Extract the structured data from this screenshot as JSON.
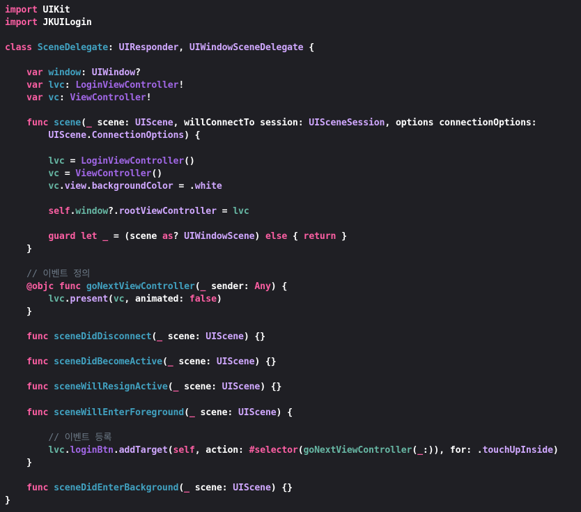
{
  "colors": {
    "background": "#1f1f24",
    "plain": "#ffffff",
    "keyword": "#fc5fa3",
    "type": "#d0a8ff",
    "project_type": "#a167e6",
    "declaration": "#41a1c0",
    "project_name": "#67b7a4",
    "project_member": "#a167e6",
    "comment": "#6c7986"
  },
  "lines": [
    [
      [
        "keyword",
        "import"
      ],
      [
        "plain",
        " UIKit"
      ]
    ],
    [
      [
        "keyword",
        "import"
      ],
      [
        "plain",
        " JKUILogin"
      ]
    ],
    [],
    [
      [
        "keyword",
        "class"
      ],
      [
        "plain",
        " "
      ],
      [
        "declaration",
        "SceneDelegate"
      ],
      [
        "plain",
        ": "
      ],
      [
        "type",
        "UIResponder"
      ],
      [
        "plain",
        ", "
      ],
      [
        "type",
        "UIWindowSceneDelegate"
      ],
      [
        "plain",
        " {"
      ]
    ],
    [],
    [
      [
        "plain",
        "    "
      ],
      [
        "keyword",
        "var"
      ],
      [
        "plain",
        " "
      ],
      [
        "declaration",
        "window"
      ],
      [
        "plain",
        ": "
      ],
      [
        "type",
        "UIWindow"
      ],
      [
        "plain",
        "?"
      ]
    ],
    [
      [
        "plain",
        "    "
      ],
      [
        "keyword",
        "var"
      ],
      [
        "plain",
        " "
      ],
      [
        "declaration",
        "lvc"
      ],
      [
        "plain",
        ": "
      ],
      [
        "project_type",
        "LoginViewController"
      ],
      [
        "plain",
        "!"
      ]
    ],
    [
      [
        "plain",
        "    "
      ],
      [
        "keyword",
        "var"
      ],
      [
        "plain",
        " "
      ],
      [
        "declaration",
        "vc"
      ],
      [
        "plain",
        ": "
      ],
      [
        "project_type",
        "ViewController"
      ],
      [
        "plain",
        "!"
      ]
    ],
    [],
    [
      [
        "plain",
        "    "
      ],
      [
        "keyword",
        "func"
      ],
      [
        "plain",
        " "
      ],
      [
        "declaration",
        "scene"
      ],
      [
        "plain",
        "("
      ],
      [
        "keyword",
        "_"
      ],
      [
        "plain",
        " scene: "
      ],
      [
        "type",
        "UIScene"
      ],
      [
        "plain",
        ", willConnectTo session: "
      ],
      [
        "type",
        "UISceneSession"
      ],
      [
        "plain",
        ", options connectionOptions:"
      ]
    ],
    [
      [
        "plain",
        "        "
      ],
      [
        "type",
        "UIScene"
      ],
      [
        "plain",
        "."
      ],
      [
        "type",
        "ConnectionOptions"
      ],
      [
        "plain",
        ") {"
      ]
    ],
    [],
    [
      [
        "plain",
        "        "
      ],
      [
        "project_name",
        "lvc"
      ],
      [
        "plain",
        " = "
      ],
      [
        "project_type",
        "LoginViewController"
      ],
      [
        "plain",
        "()"
      ]
    ],
    [
      [
        "plain",
        "        "
      ],
      [
        "project_name",
        "vc"
      ],
      [
        "plain",
        " = "
      ],
      [
        "project_type",
        "ViewController"
      ],
      [
        "plain",
        "()"
      ]
    ],
    [
      [
        "plain",
        "        "
      ],
      [
        "project_name",
        "vc"
      ],
      [
        "plain",
        "."
      ],
      [
        "type",
        "view"
      ],
      [
        "plain",
        "."
      ],
      [
        "type",
        "backgroundColor"
      ],
      [
        "plain",
        " = ."
      ],
      [
        "type",
        "white"
      ]
    ],
    [],
    [
      [
        "plain",
        "        "
      ],
      [
        "keyword",
        "self"
      ],
      [
        "plain",
        "."
      ],
      [
        "project_name",
        "window"
      ],
      [
        "plain",
        "?."
      ],
      [
        "type",
        "rootViewController"
      ],
      [
        "plain",
        " = "
      ],
      [
        "project_name",
        "lvc"
      ]
    ],
    [],
    [
      [
        "plain",
        "        "
      ],
      [
        "keyword",
        "guard"
      ],
      [
        "plain",
        " "
      ],
      [
        "keyword",
        "let"
      ],
      [
        "plain",
        " "
      ],
      [
        "keyword",
        "_"
      ],
      [
        "plain",
        " = (scene "
      ],
      [
        "keyword",
        "as"
      ],
      [
        "plain",
        "? "
      ],
      [
        "type",
        "UIWindowScene"
      ],
      [
        "plain",
        ") "
      ],
      [
        "keyword",
        "else"
      ],
      [
        "plain",
        " { "
      ],
      [
        "keyword",
        "return"
      ],
      [
        "plain",
        " }"
      ]
    ],
    [
      [
        "plain",
        "    }"
      ]
    ],
    [],
    [
      [
        "plain",
        "    "
      ],
      [
        "comment",
        "// 이벤트 정의"
      ]
    ],
    [
      [
        "plain",
        "    "
      ],
      [
        "keyword",
        "@objc"
      ],
      [
        "plain",
        " "
      ],
      [
        "keyword",
        "func"
      ],
      [
        "plain",
        " "
      ],
      [
        "declaration",
        "goNextViewController"
      ],
      [
        "plain",
        "("
      ],
      [
        "keyword",
        "_"
      ],
      [
        "plain",
        " sender: "
      ],
      [
        "keyword",
        "Any"
      ],
      [
        "plain",
        ") {"
      ]
    ],
    [
      [
        "plain",
        "        "
      ],
      [
        "project_name",
        "lvc"
      ],
      [
        "plain",
        "."
      ],
      [
        "type",
        "present"
      ],
      [
        "plain",
        "("
      ],
      [
        "project_name",
        "vc"
      ],
      [
        "plain",
        ", animated: "
      ],
      [
        "keyword",
        "false"
      ],
      [
        "plain",
        ")"
      ]
    ],
    [
      [
        "plain",
        "    }"
      ]
    ],
    [],
    [
      [
        "plain",
        "    "
      ],
      [
        "keyword",
        "func"
      ],
      [
        "plain",
        " "
      ],
      [
        "declaration",
        "sceneDidDisconnect"
      ],
      [
        "plain",
        "("
      ],
      [
        "keyword",
        "_"
      ],
      [
        "plain",
        " scene: "
      ],
      [
        "type",
        "UIScene"
      ],
      [
        "plain",
        ") {}"
      ]
    ],
    [],
    [
      [
        "plain",
        "    "
      ],
      [
        "keyword",
        "func"
      ],
      [
        "plain",
        " "
      ],
      [
        "declaration",
        "sceneDidBecomeActive"
      ],
      [
        "plain",
        "("
      ],
      [
        "keyword",
        "_"
      ],
      [
        "plain",
        " scene: "
      ],
      [
        "type",
        "UIScene"
      ],
      [
        "plain",
        ") {}"
      ]
    ],
    [],
    [
      [
        "plain",
        "    "
      ],
      [
        "keyword",
        "func"
      ],
      [
        "plain",
        " "
      ],
      [
        "declaration",
        "sceneWillResignActive"
      ],
      [
        "plain",
        "("
      ],
      [
        "keyword",
        "_"
      ],
      [
        "plain",
        " scene: "
      ],
      [
        "type",
        "UIScene"
      ],
      [
        "plain",
        ") {}"
      ]
    ],
    [],
    [
      [
        "plain",
        "    "
      ],
      [
        "keyword",
        "func"
      ],
      [
        "plain",
        " "
      ],
      [
        "declaration",
        "sceneWillEnterForeground"
      ],
      [
        "plain",
        "("
      ],
      [
        "keyword",
        "_"
      ],
      [
        "plain",
        " scene: "
      ],
      [
        "type",
        "UIScene"
      ],
      [
        "plain",
        ") {"
      ]
    ],
    [],
    [
      [
        "plain",
        "        "
      ],
      [
        "comment",
        "// 이벤트 등록"
      ]
    ],
    [
      [
        "plain",
        "        "
      ],
      [
        "project_name",
        "lvc"
      ],
      [
        "plain",
        "."
      ],
      [
        "project_member",
        "loginBtn"
      ],
      [
        "plain",
        "."
      ],
      [
        "type",
        "addTarget"
      ],
      [
        "plain",
        "("
      ],
      [
        "keyword",
        "self"
      ],
      [
        "plain",
        ", action: "
      ],
      [
        "keyword",
        "#selector"
      ],
      [
        "plain",
        "("
      ],
      [
        "project_name",
        "goNextViewController"
      ],
      [
        "plain",
        "("
      ],
      [
        "keyword",
        "_"
      ],
      [
        "plain",
        ":)), for: ."
      ],
      [
        "type",
        "touchUpInside"
      ],
      [
        "plain",
        ")"
      ]
    ],
    [
      [
        "plain",
        "    }"
      ]
    ],
    [],
    [
      [
        "plain",
        "    "
      ],
      [
        "keyword",
        "func"
      ],
      [
        "plain",
        " "
      ],
      [
        "declaration",
        "sceneDidEnterBackground"
      ],
      [
        "plain",
        "("
      ],
      [
        "keyword",
        "_"
      ],
      [
        "plain",
        " scene: "
      ],
      [
        "type",
        "UIScene"
      ],
      [
        "plain",
        ") {}"
      ]
    ],
    [
      [
        "plain",
        "}"
      ]
    ]
  ]
}
